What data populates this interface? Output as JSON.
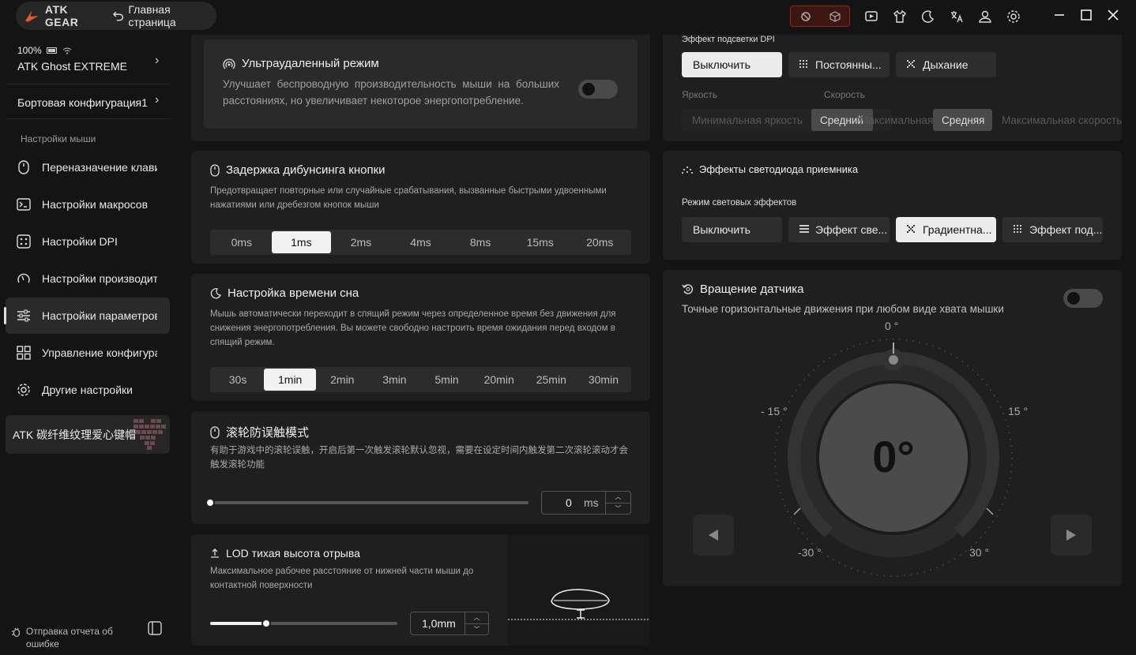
{
  "titlebar": {
    "brand": "ATK GEAR",
    "home": "Главная страница"
  },
  "sidebar": {
    "battery": "100%",
    "device": "ATK Ghost EXTREME",
    "config": "Бортовая конфигурация1",
    "section": "Настройки мыши",
    "items": [
      {
        "label": "Переназначение клавиш"
      },
      {
        "label": "Настройки макросов"
      },
      {
        "label": "Настройки DPI"
      },
      {
        "label": "Настройки производительности"
      },
      {
        "label": "Настройки параметров"
      },
      {
        "label": "Управление конфигурациями"
      },
      {
        "label": "Другие настройки"
      }
    ],
    "promo": "ATK 碳纤维纹理爱心键帽",
    "report": "Отправка отчета об ошибке"
  },
  "ultra": {
    "title": "Ультраудаленный режим",
    "desc": "Улучшает беспроводную производительность мыши на больших расстояниях, но увеличивает некоторое энергопотребление.",
    "enabled": false
  },
  "debounce": {
    "title": "Задержка дибунсинга кнопки",
    "desc": "Предотвращает повторные или случайные срабатывания, вызванные быстрыми удвоенными нажатиями или дребезгом кнопок мыши",
    "options": [
      "0ms",
      "1ms",
      "2ms",
      "4ms",
      "8ms",
      "15ms",
      "20ms"
    ],
    "selected": "1ms"
  },
  "sleep": {
    "title": "Настройка времени сна",
    "desc": "Мышь автоматически переходит в спящий режим через определенное время без движения для снижения энергопотребления. Вы можете свободно настроить время ожидания перед входом в спящий режим.",
    "options": [
      "30s",
      "1min",
      "2min",
      "3min",
      "5min",
      "20min",
      "25min",
      "30min"
    ],
    "selected": "1min"
  },
  "scroll": {
    "title": "滚轮防误触模式",
    "desc": "有助于游戏中的滚轮误触，开启后第一次触发滚轮默认忽视，需要在设定时间内触发第二次滚轮滚动才会触发滚轮功能",
    "value": "0",
    "unit": "ms",
    "fraction": 0
  },
  "lod": {
    "title": "LOD тихая высота отрыва",
    "desc": "Максимальное рабочее расстояние от нижней части мыши до контактной поверхности",
    "value": "1,0mm",
    "fraction": 0.3
  },
  "backlight": {
    "title": "Эффект подсветки DPI",
    "buttons": [
      "Выключить",
      "Постоянны...",
      "Дыхание"
    ],
    "brightness_label": "Яркость",
    "speed_label": "Скорость",
    "brightness_min": "Минимальная яркость",
    "brightness_mid": "Средний",
    "brightness_max": "Максимальная яркость",
    "speed_min": "Минимальная скорость",
    "speed_mid": "Средняя",
    "speed_max": "Максимальная скорость"
  },
  "receiver": {
    "title": "Эффекты светодиода приемника",
    "mode_label": "Режим световых эффектов",
    "buttons": [
      "Выключить",
      "Эффект све...",
      "Градиентна...",
      "Эффект под..."
    ]
  },
  "sensor": {
    "title": "Вращение датчика",
    "desc": "Точные горизонтальные движения при любом виде хвата мышки",
    "enabled": false,
    "value": "0°",
    "ticks": {
      "top": "0 °",
      "left": "- 15 °",
      "right": "15 °",
      "bl": "-30 °",
      "br": "30 °"
    }
  },
  "colors": {
    "accent": "#f0f0f0",
    "bg": "#141414",
    "card": "#1f1f1f",
    "danger": "#8a2a1e"
  }
}
